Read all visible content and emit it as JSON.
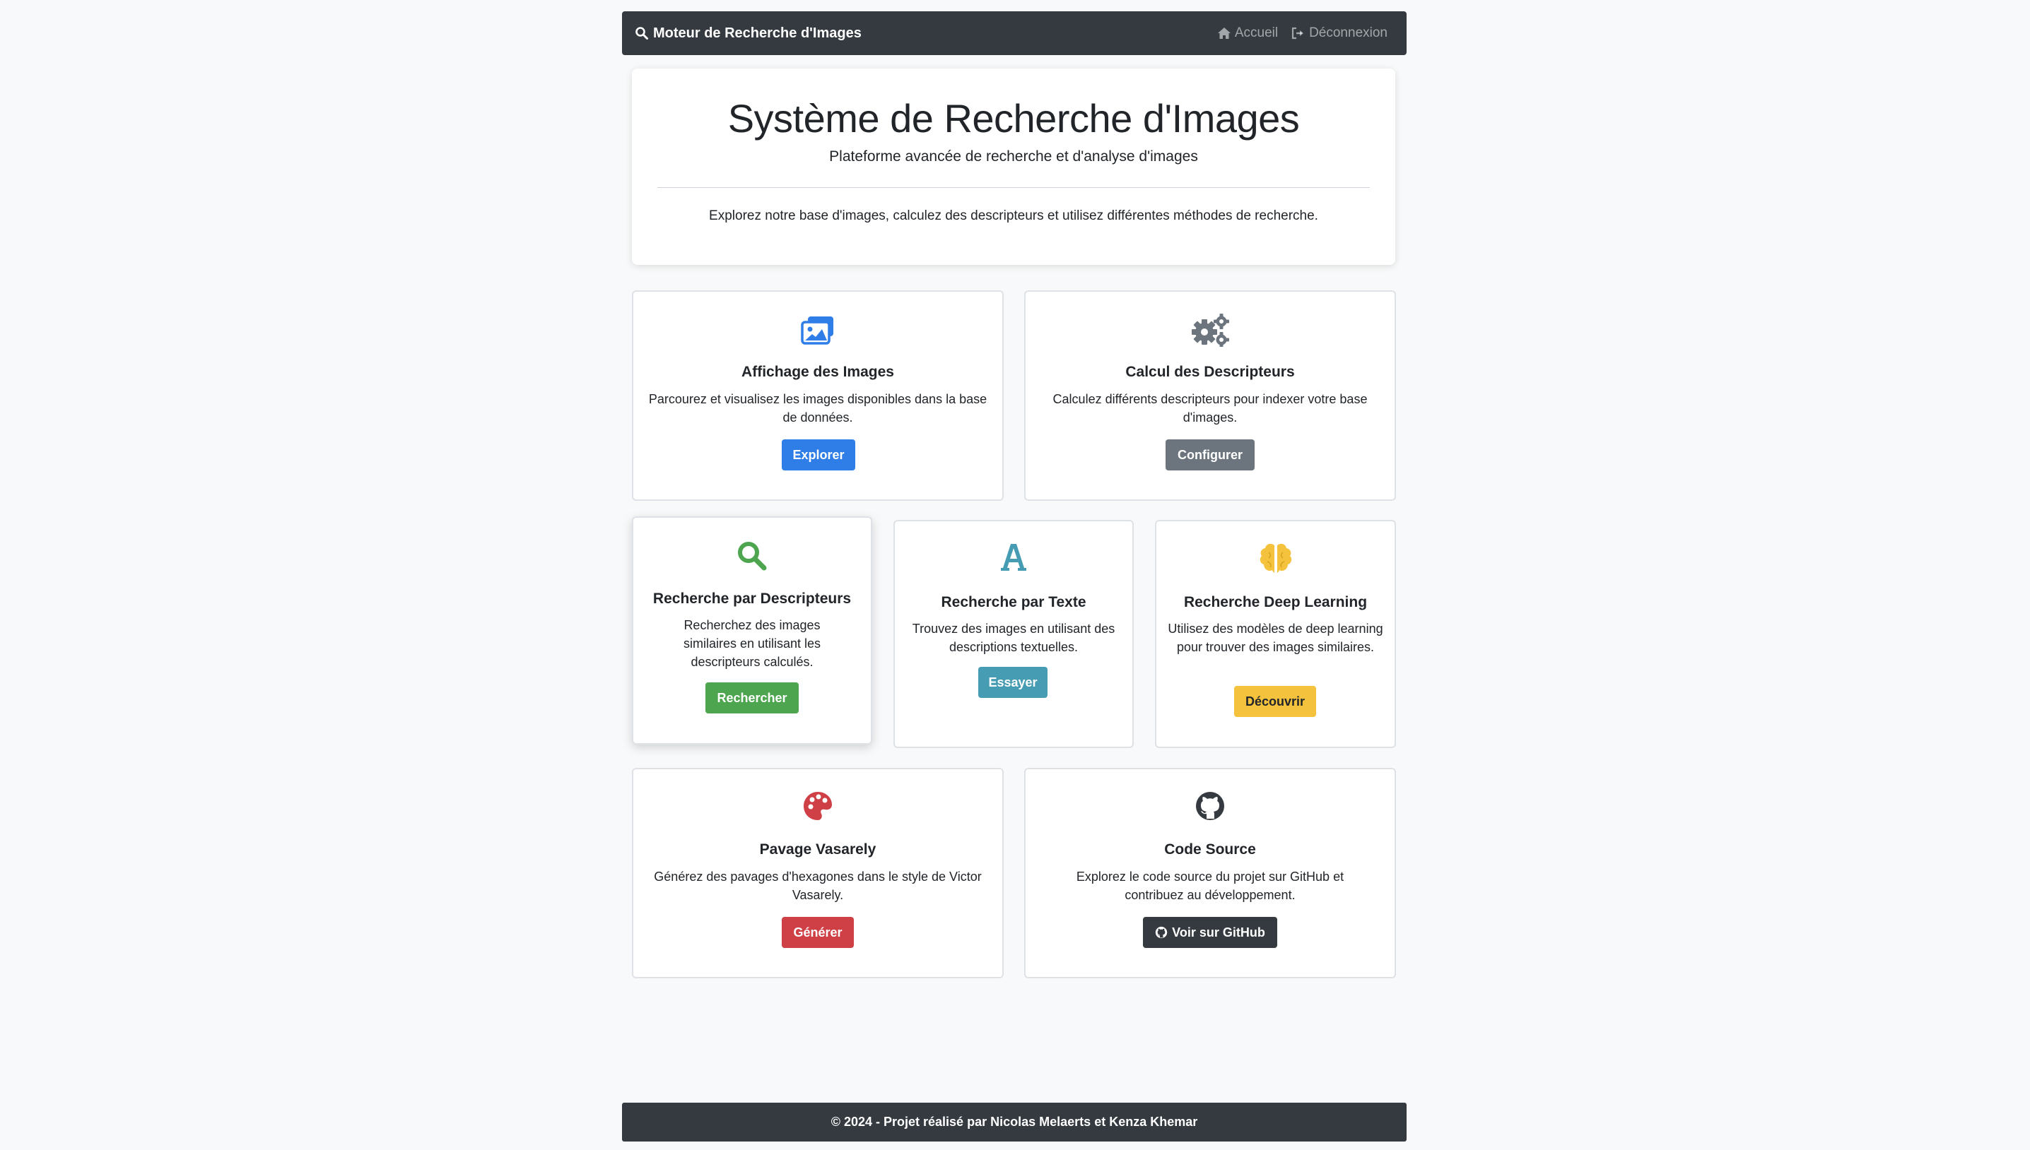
{
  "navbar": {
    "brand_label": "Moteur de Recherche d'Images",
    "brand_icon": "search-icon",
    "links": [
      {
        "label": "Accueil",
        "icon": "home-icon"
      },
      {
        "label": "Déconnexion",
        "icon": "sign-out-icon"
      }
    ]
  },
  "hero": {
    "title": "Système de Recherche d'Images",
    "lead": "Plateforme avancée de recherche et d'analyse d'images",
    "description": "Explorez notre base d'images, calculez des descripteurs et utilisez différentes méthodes de recherche."
  },
  "cards": {
    "images": {
      "icon": "images-icon",
      "title": "Affichage des Images",
      "text": "Parcourez et visualisez les images disponibles dans la base de données.",
      "button": "Explorer"
    },
    "descriptors": {
      "icon": "cogs-icon",
      "title": "Calcul des Descripteurs",
      "text": "Calculez différents descripteurs pour indexer votre base d'images.",
      "button": "Configurer"
    },
    "search_descriptors": {
      "icon": "search-icon",
      "title": "Recherche par Descripteurs",
      "text": "Recherchez des images similaires en utilisant les descripteurs calculés.",
      "button": "Rechercher"
    },
    "search_text": {
      "icon": "font-icon",
      "title": "Recherche par Texte",
      "text": "Trouvez des images en utilisant des descriptions textuelles.",
      "button": "Essayer"
    },
    "deep_learning": {
      "icon": "brain-icon",
      "title": "Recherche Deep Learning",
      "text": "Utilisez des modèles de deep learning pour trouver des images similaires.",
      "button": "Découvrir"
    },
    "vasarely": {
      "icon": "palette-icon",
      "title": "Pavage Vasarely",
      "text": "Générez des pavages d'hexagones dans le style de Victor Vasarely.",
      "button": "Générer"
    },
    "source": {
      "icon": "github-icon",
      "title": "Code Source",
      "text": "Explorez le code source du projet sur GitHub et contribuez au développement.",
      "button": "Voir sur GitHub"
    }
  },
  "footer": {
    "prefix": "© 2024 - Projet réalisé par",
    "author1": "Nicolas Melaerts",
    "conjunction": "et",
    "author2": "Kenza Khemar"
  },
  "colors": {
    "primary": "#2f7ee8",
    "secondary": "#6c757d",
    "success": "#4ea54f",
    "info": "#469cb2",
    "warning": "#f4c23c",
    "danger": "#cf3f46",
    "dark": "#343a40"
  }
}
